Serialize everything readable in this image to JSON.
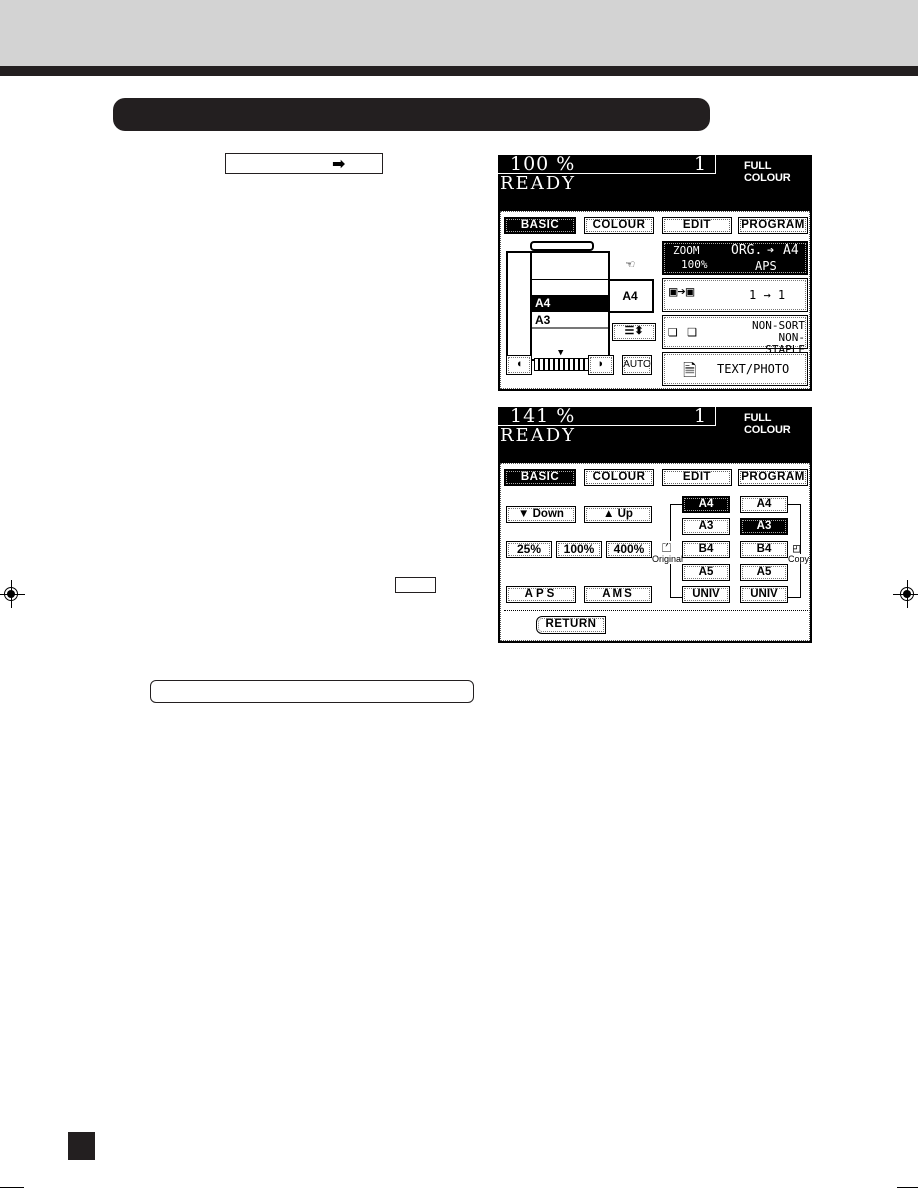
{
  "page": {
    "header_band_color": "#d3d3d3",
    "rule_color": "#231f20",
    "arrow_glyph": "➡",
    "arrow_icon": "right-arrow-icon"
  },
  "screen1": {
    "zoom": "100 %",
    "copies": "1",
    "colour_mode": "FULL COLOUR",
    "status": "READY",
    "tabs": [
      {
        "label": "BASIC",
        "active": true
      },
      {
        "label": "COLOUR",
        "active": false
      },
      {
        "label": "EDIT",
        "active": false
      },
      {
        "label": "PROGRAM",
        "active": false
      }
    ],
    "cassettes": [
      "A4",
      "A3"
    ],
    "selected_cassette": "A4",
    "bypass_size": "A4",
    "density_buttons": {
      "lighter": "◖",
      "darker": "◗",
      "auto": "AUTO"
    },
    "zoom_panel": {
      "zoom_label": "ZOOM",
      "zoom_value": "100%",
      "org_label": "ORG.",
      "org_arrow": "➔",
      "org_size": "A4",
      "mode": "APS"
    },
    "duplex_panel": {
      "label": "1 → 1"
    },
    "finisher_panel": {
      "line1": "NON-SORT",
      "line2": "NON-STAPLE"
    },
    "image_mode_panel": {
      "label": "TEXT/PHOTO"
    }
  },
  "screen2": {
    "zoom": "141 %",
    "copies": "1",
    "colour_mode": "FULL COLOUR",
    "status": "READY",
    "tabs": [
      {
        "label": "BASIC",
        "active": true
      },
      {
        "label": "COLOUR",
        "active": false
      },
      {
        "label": "EDIT",
        "active": false
      },
      {
        "label": "PROGRAM",
        "active": false
      }
    ],
    "down_label": "▼ Down",
    "up_label": "▲ Up",
    "presets": [
      "25%",
      "100%",
      "400%"
    ],
    "aps_label": "APS",
    "ams_label": "AMS",
    "return_label": "RETURN",
    "original_label": "Original",
    "copy_label": "Copy",
    "original_sizes": [
      "A4",
      "A3",
      "B4",
      "A5",
      "UNIV"
    ],
    "copy_sizes": [
      "A4",
      "A3",
      "B4",
      "A5",
      "UNIV"
    ],
    "selected_original": "A4",
    "selected_copy": "A3"
  }
}
